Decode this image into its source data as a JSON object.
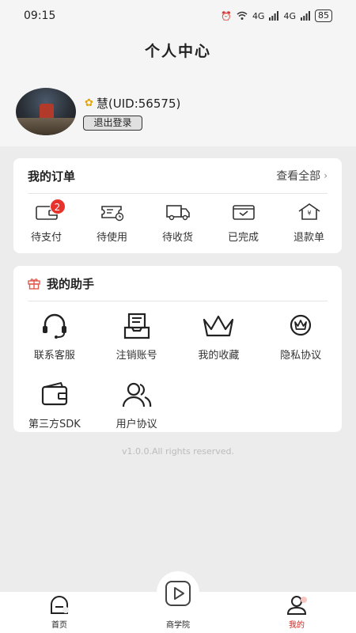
{
  "status_bar": {
    "time": "09:15",
    "net_1": "4G",
    "net_2": "4G",
    "battery": "85"
  },
  "header": {
    "title": "个人中心",
    "username": "慧(UID:56575)",
    "logout_label": "退出登录"
  },
  "orders": {
    "title": "我的订单",
    "view_all": "查看全部",
    "items": [
      {
        "label": "待支付",
        "badge": "2",
        "icon": "wallet-icon"
      },
      {
        "label": "待使用",
        "icon": "ticket-icon"
      },
      {
        "label": "待收货",
        "icon": "truck-icon"
      },
      {
        "label": "已完成",
        "icon": "completed-box-icon"
      },
      {
        "label": "退款单",
        "icon": "refund-house-icon"
      }
    ]
  },
  "helper": {
    "title": "我的助手",
    "items": [
      {
        "label": "联系客服",
        "icon": "headset-icon"
      },
      {
        "label": "注销账号",
        "icon": "inbox-tray-icon"
      },
      {
        "label": "我的收藏",
        "icon": "crown-icon"
      },
      {
        "label": "隐私协议",
        "icon": "crown-badge-icon"
      },
      {
        "label": "第三方SDK",
        "icon": "wallet-card-icon"
      },
      {
        "label": "用户协议",
        "icon": "users-icon"
      }
    ]
  },
  "copyright": "v1.0.0.All rights reserved.",
  "tabs": [
    {
      "label": "首页",
      "icon": "home-icon",
      "active": false
    },
    {
      "label": "商学院",
      "icon": "play-icon",
      "active": false
    },
    {
      "label": "我的",
      "icon": "user-icon",
      "active": true
    }
  ],
  "colors": {
    "accent": "#d0241c",
    "badge": "#e8332c",
    "background": "#ececec"
  }
}
